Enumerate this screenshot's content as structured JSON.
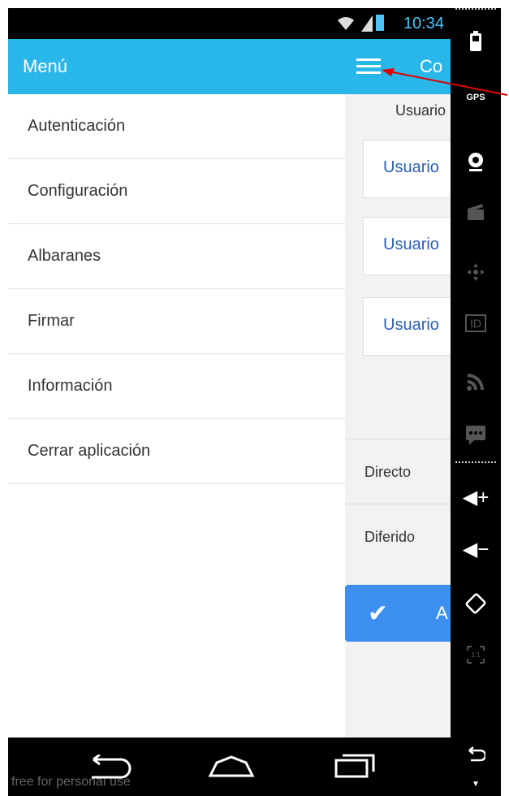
{
  "status_bar": {
    "time": "10:34"
  },
  "drawer": {
    "title": "Menú",
    "items": [
      {
        "label": "Autenticación"
      },
      {
        "label": "Configuración"
      },
      {
        "label": "Albaranes"
      },
      {
        "label": "Firmar"
      },
      {
        "label": "Información"
      },
      {
        "label": "Cerrar aplicación"
      }
    ]
  },
  "main": {
    "title": "Co",
    "user_label": "Usuario",
    "user_cards": [
      {
        "label": "Usuario"
      },
      {
        "label": "Usuario"
      },
      {
        "label": "Usuario"
      }
    ],
    "options": [
      {
        "label": "Directo"
      },
      {
        "label": "Diferido"
      }
    ],
    "accept_label": "A"
  },
  "toolbar": {
    "gps_label": "GPS",
    "id_label": "ID",
    "volume_up": "◀+",
    "volume_down": "◀−"
  },
  "navbar": {
    "watermark": "free for personal use"
  },
  "colors": {
    "header": "#29b6e8",
    "link": "#2b5fb3",
    "button": "#3d8ff0",
    "annotation": "#e00000"
  }
}
